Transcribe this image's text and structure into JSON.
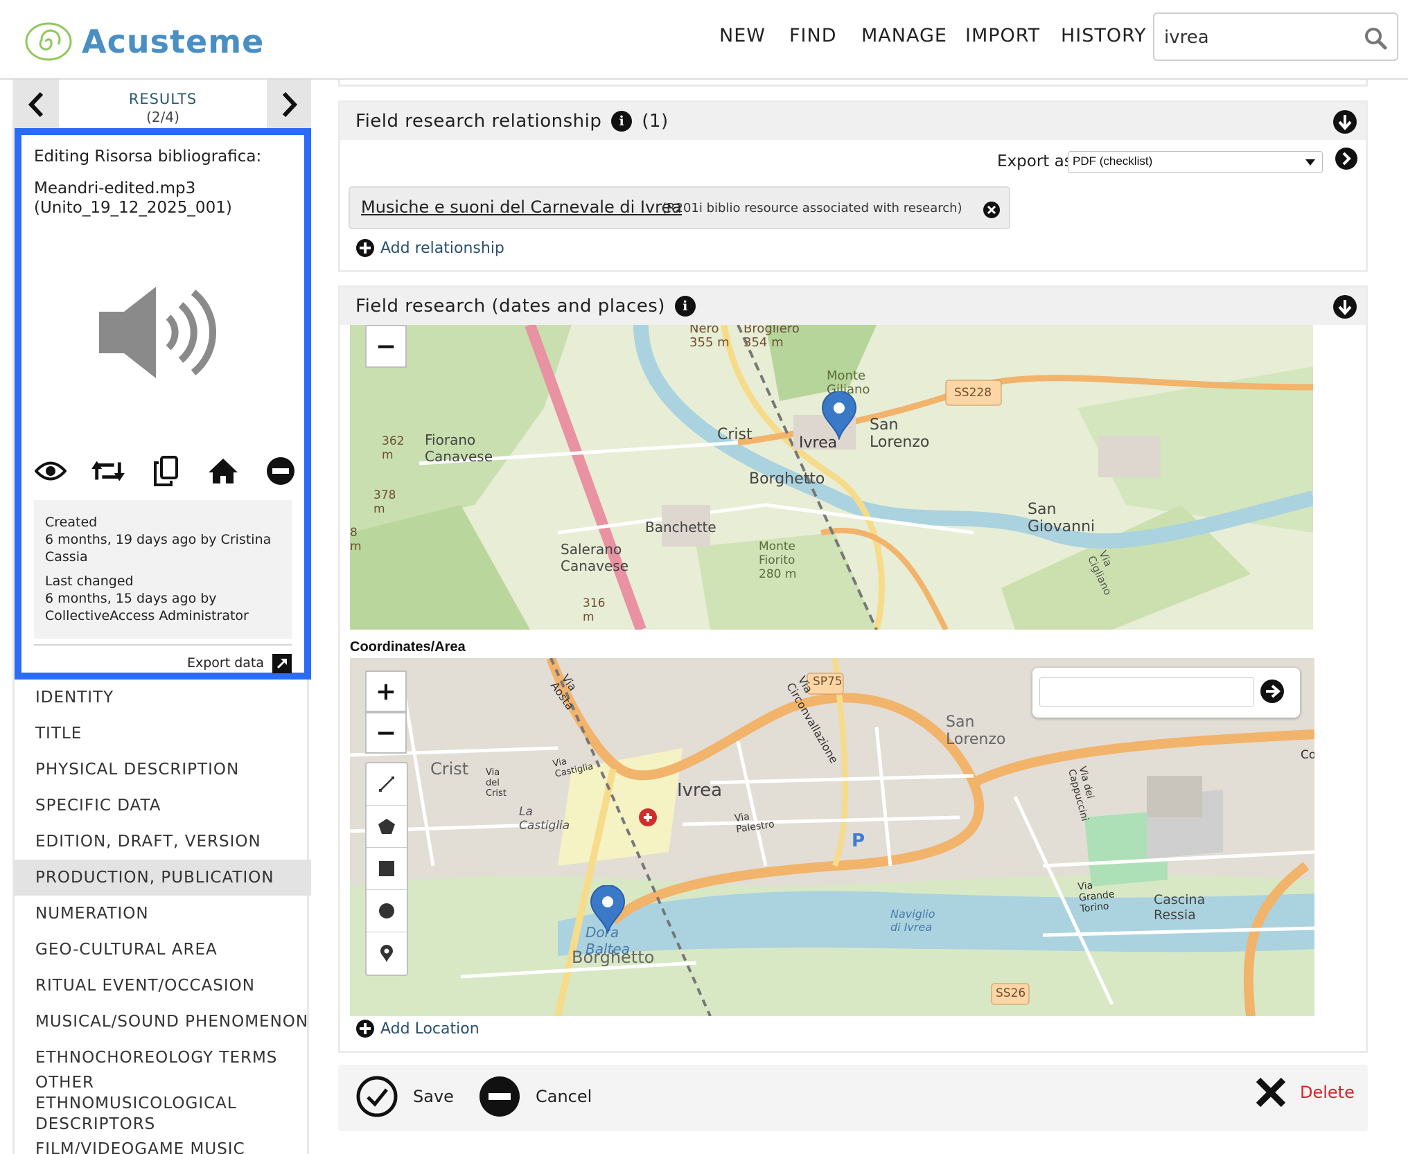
{
  "header": {
    "logo_text_a": "Acus",
    "logo_text_b": "teme",
    "nav": [
      "NEW",
      "FIND",
      "MANAGE",
      "IMPORT",
      "HISTORY"
    ],
    "search_value": "ivrea"
  },
  "results": {
    "label": "RESULTS",
    "count": "(2/4)"
  },
  "editing": {
    "label": "Editing Risorsa bibliografica:",
    "filename": "Meandri-edited.mp3",
    "identifier": "(Unito_19_12_2025_001)"
  },
  "meta": {
    "created_label": "Created",
    "created_value": "6 months, 19 days ago by Cristina Cassia",
    "changed_label": "Last changed",
    "changed_value": "6 months, 15 days ago by CollectiveAccess Administrator",
    "export_label": "Export data"
  },
  "sections": [
    "IDENTITY",
    "TITLE",
    "PHYSICAL DESCRIPTION",
    "SPECIFIC DATA",
    "EDITION, DRAFT, VERSION",
    "PRODUCTION, PUBLICATION",
    "NUMERATION",
    "GEO-CULTURAL AREA",
    "RITUAL EVENT/OCCASION",
    "MUSICAL/SOUND PHENOMENON",
    "ETHNOCHOREOLOGY TERMS",
    "OTHER ETHNOMUSICOLOGICAL DESCRIPTORS",
    "FILM/VIDEOGAME MUSIC"
  ],
  "active_section": "PRODUCTION, PUBLICATION",
  "relationship": {
    "title": "Field research relationship",
    "count": "(1)",
    "export_as_label": "Export as",
    "export_format": "PDF (checklist)",
    "item_link": "Musiche e suoni del Carnevale di Ivrea",
    "item_desc": "(R201i biblio resource associated with research)",
    "add_label": "Add relationship"
  },
  "places": {
    "title": "Field research (dates and places)",
    "coords_label": "Coordinates/Area",
    "add_label": "Add Location",
    "map_overview_labels": [
      "Nero 355 m",
      "Brogliero 354 m",
      "Monte Giliano",
      "SS228",
      "362 m",
      "Fiorano Canavese",
      "Crist",
      "Ivrea",
      "San Lorenzo",
      "Borghetto",
      "378 m",
      "San Giovanni",
      "Banchette",
      "Salerano Canavese",
      "Monte Fiorito 280 m",
      "316 m",
      "Via Cigliano",
      "8 m"
    ],
    "map_detail_labels": [
      "Via Aosta",
      "SP75",
      "Via Circonvallazione",
      "San Lorenzo",
      "Crist",
      "Via del Crist",
      "Via Castiglia",
      "Ivrea",
      "La Castiglia",
      "Via Palestro",
      "Via dei Cappuccini",
      "Via Grande Torino",
      "Cascina Ressia",
      "Naviglio di Ivrea",
      "Dora Baltea",
      "Borghetto",
      "SS26",
      "Co"
    ]
  },
  "footer": {
    "save": "Save",
    "cancel": "Cancel",
    "delete": "Delete"
  },
  "colors": {
    "accent_blue": "#2a6cf6",
    "delete_red": "#d6242b",
    "logo_blue": "#4a8fc4",
    "marker_blue": "#3a78c8"
  }
}
